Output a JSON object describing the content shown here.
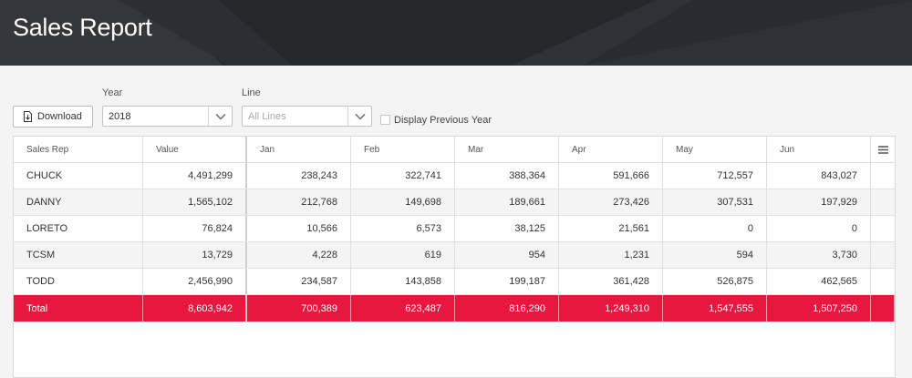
{
  "header": {
    "title": "Sales Report"
  },
  "toolbar": {
    "download_label": "Download",
    "year_label": "Year",
    "year_value": "2018",
    "line_label": "Line",
    "line_placeholder": "All Lines",
    "prev_year_label": "Display Previous Year",
    "prev_year_checked": false
  },
  "table": {
    "headers": {
      "rep": "Sales Rep",
      "value": "Value",
      "jan": "Jan",
      "feb": "Feb",
      "mar": "Mar",
      "apr": "Apr",
      "may": "May",
      "jun": "Jun"
    },
    "rows": [
      {
        "rep": "CHUCK",
        "value": "4,491,299",
        "jan": "238,243",
        "feb": "322,741",
        "mar": "388,364",
        "apr": "591,666",
        "may": "712,557",
        "jun": "843,027"
      },
      {
        "rep": "DANNY",
        "value": "1,565,102",
        "jan": "212,768",
        "feb": "149,698",
        "mar": "189,661",
        "apr": "273,426",
        "may": "307,531",
        "jun": "197,929"
      },
      {
        "rep": "LORETO",
        "value": "76,824",
        "jan": "10,566",
        "feb": "6,573",
        "mar": "38,125",
        "apr": "21,561",
        "may": "0",
        "jun": "0"
      },
      {
        "rep": "TCSM",
        "value": "13,729",
        "jan": "4,228",
        "feb": "619",
        "mar": "954",
        "apr": "1,231",
        "may": "594",
        "jun": "3,730"
      },
      {
        "rep": "TODD",
        "value": "2,456,990",
        "jan": "234,587",
        "feb": "143,858",
        "mar": "199,187",
        "apr": "361,428",
        "may": "526,875",
        "jun": "462,565"
      }
    ],
    "total": {
      "rep": "Total",
      "value": "8,603,942",
      "jan": "700,389",
      "feb": "623,487",
      "mar": "816,290",
      "apr": "1,249,310",
      "may": "1,547,555",
      "jun": "1,507,250"
    }
  },
  "colors": {
    "header_bg": "#26272b",
    "total_row": "#e8173f",
    "alt_row": "#f4f4f4"
  },
  "icons": {
    "download": "download-file-icon",
    "caret": "chevron-down-icon",
    "columns_menu": "hamburger-menu-icon"
  }
}
